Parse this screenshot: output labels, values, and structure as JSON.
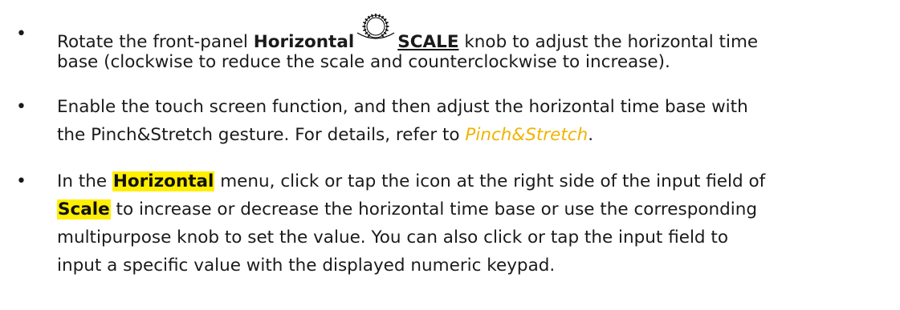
{
  "bullets": [
    {
      "symbol": "•",
      "line1_pre": "Rotate the front-panel ",
      "line1_bold": "Horizontal",
      "knob_icon": "rotary-knob-icon",
      "line1_under": "SCALE",
      "line1_post": " knob to adjust the horizontal time",
      "line2": "base (clockwise to reduce the scale and counterclockwise to increase)."
    },
    {
      "symbol": "•",
      "line1": "Enable the touch screen function, and then adjust the horizontal time base with",
      "line2_pre": "the Pinch&Stretch gesture. For details, refer to ",
      "line2_link": "Pinch&Stretch",
      "line2_post": "."
    },
    {
      "symbol": "•",
      "line1_pre": "In the ",
      "line1_hl": "Horizontal",
      "line1_post": " menu, click or tap the icon at the right side of the input field of",
      "line2_hl": "Scale",
      "line2_post": " to increase or decrease the horizontal time base or use the corresponding",
      "line3": "multipurpose knob to set the value. You can also click or tap the input field to",
      "line4": "input a specific value with the displayed numeric keypad."
    }
  ],
  "colors": {
    "highlight": "#ffef00",
    "link": "#f0b400",
    "text": "#1a1a1a"
  }
}
